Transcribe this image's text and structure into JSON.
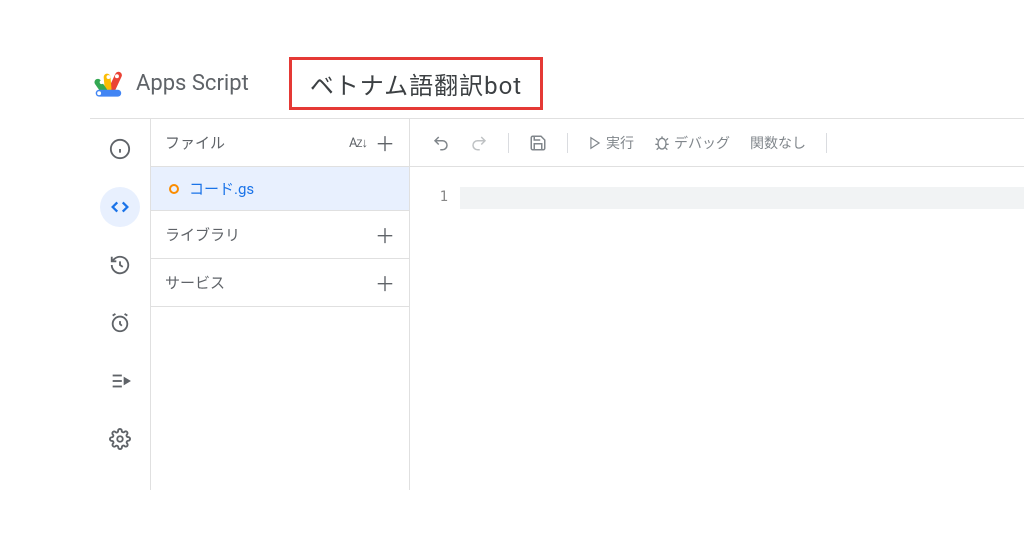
{
  "header": {
    "app_name": "Apps Script",
    "project_title": "ベトナム語翻訳bot"
  },
  "sidebar": {
    "files_label": "ファイル",
    "file_name": "コード.gs",
    "libraries_label": "ライブラリ",
    "services_label": "サービス"
  },
  "toolbar": {
    "run_label": "実行",
    "debug_label": "デバッグ",
    "function_select": "関数なし"
  },
  "editor": {
    "line_number": "1"
  }
}
